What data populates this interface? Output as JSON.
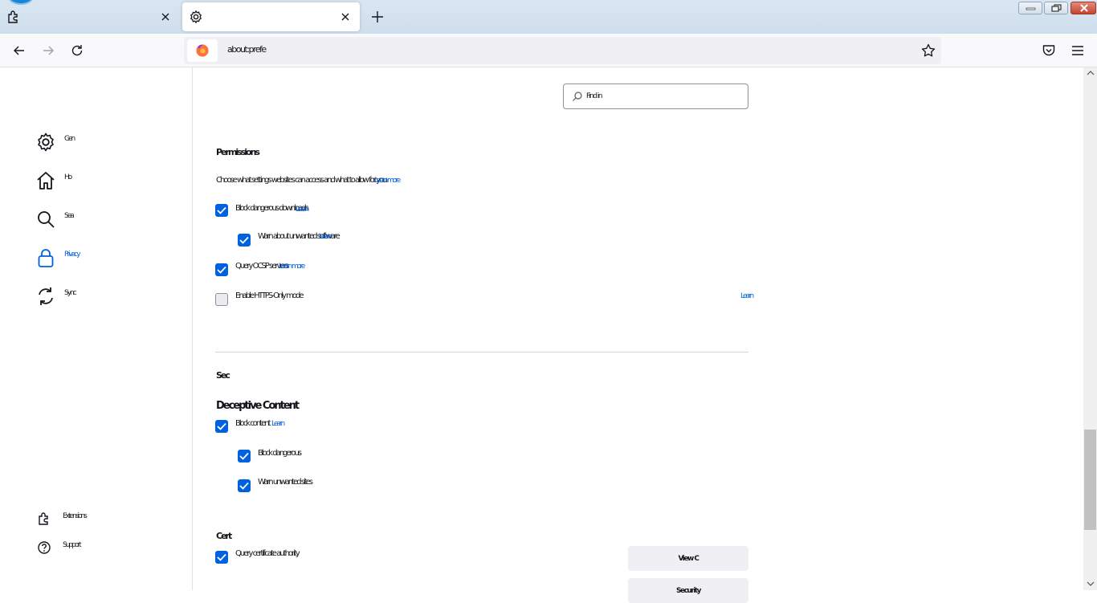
{
  "browser": {
    "tabs": [
      {
        "label": ""
      },
      {
        "label": ""
      }
    ],
    "url": "about:prefe",
    "colors": {
      "accent": "#0061e0",
      "tab_strip": "#d9e6f2"
    }
  },
  "sidebar": {
    "categories": [
      {
        "label": "Gen",
        "icon": "gear-icon"
      },
      {
        "label": "Ho",
        "icon": "home-icon"
      },
      {
        "label": "Sea",
        "icon": "search-icon"
      },
      {
        "label": "Privacy",
        "icon": "lock-icon",
        "selected": true
      },
      {
        "label": "Sync",
        "icon": "sync-icon"
      }
    ],
    "footer": [
      {
        "label": "Extensions",
        "icon": "puzzle-icon"
      },
      {
        "label": "Support",
        "icon": "help-icon"
      }
    ]
  },
  "search": {
    "placeholder": "Find in"
  },
  "content": {
    "section1_heading": "Permissions",
    "section1_desc": "Choose what settings websites can access and what to allow for you",
    "section1_desc_link": "Learn more",
    "items1": [
      {
        "label": "Block dangerous downloads",
        "link": "Learn",
        "checked": true
      },
      {
        "label": "Warn about unwanted software",
        "link": "Learn",
        "checked": true
      },
      {
        "label": "Query OCSP servers",
        "link": "Learn more",
        "checked": true
      },
      {
        "label": "Enable HTTPS-Only mode",
        "link": "Learn",
        "checked": false
      }
    ],
    "section2_label": "Sec",
    "section2_heading": "Deceptive Content",
    "items2": [
      {
        "label": "Block content",
        "link": "Learn",
        "checked": true
      },
      {
        "label": "Block dangerous",
        "checked": true
      },
      {
        "label": "Warn unwanted sites",
        "checked": true
      }
    ],
    "section3_label": "Cert",
    "items3": [
      {
        "label": "Query certificate authority",
        "checked": true
      }
    ],
    "buttons": {
      "view_certificates": "View C",
      "security_devices": "Security"
    }
  }
}
